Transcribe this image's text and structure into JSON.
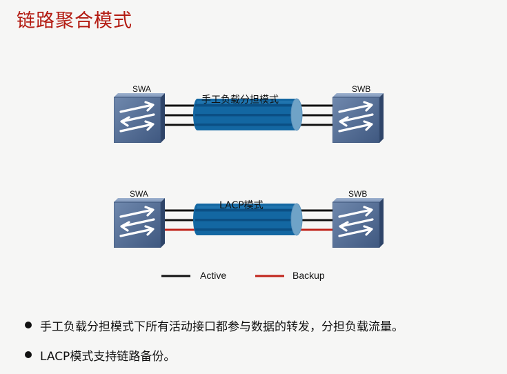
{
  "title": "链路聚合模式",
  "diagrams": [
    {
      "left_switch": "SWA",
      "right_switch": "SWB",
      "mode_label": "手工负载分担模式",
      "links": [
        "active",
        "active",
        "active"
      ]
    },
    {
      "left_switch": "SWA",
      "right_switch": "SWB",
      "mode_label": "LACP模式",
      "links": [
        "active",
        "active",
        "backup"
      ]
    }
  ],
  "legend": {
    "active_label": "Active",
    "backup_label": "Backup",
    "active_color": "#111111",
    "backup_color": "#c0231a"
  },
  "bullets": [
    "手工负载分担模式下所有活动接口都参与数据的转发，分担负载流量。",
    "LACP模式支持链路备份。"
  ]
}
